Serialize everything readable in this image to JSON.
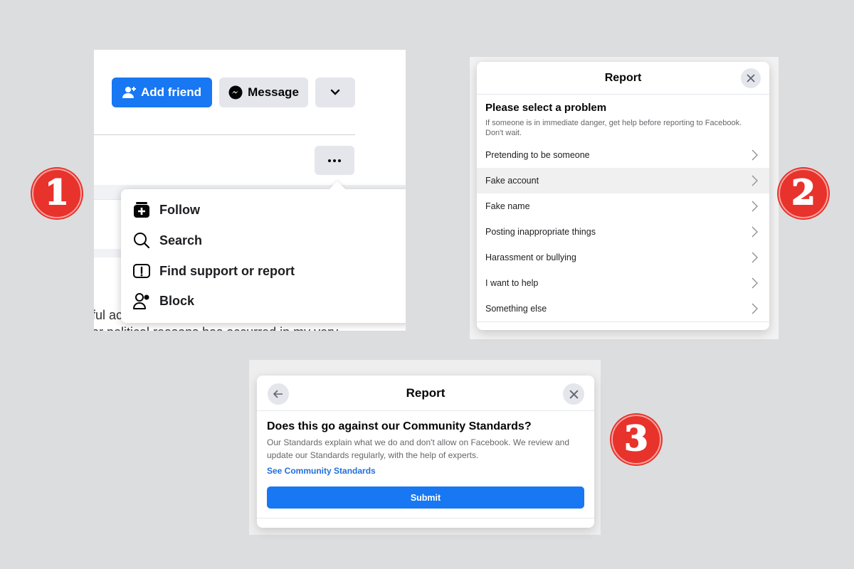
{
  "colors": {
    "background": "#dcdddf",
    "primary": "#1877f2",
    "secondary_button": "#e4e6eb",
    "link": "#216fdb",
    "badge": "#e8322c"
  },
  "step1": {
    "badge": "1",
    "profile_actions": {
      "add_friend_label": "Add friend",
      "add_friend_icon": "person-add-icon",
      "message_label": "Message",
      "message_icon": "messenger-icon",
      "more_dropdown_icon": "chevron-down-icon"
    },
    "more_button_icon": "ellipsis-icon",
    "menu": [
      {
        "label": "Follow",
        "icon": "follow-icon"
      },
      {
        "label": "Search",
        "icon": "search-icon"
      },
      {
        "label": "Find support or report",
        "icon": "report-icon"
      },
      {
        "label": "Block",
        "icon": "block-user-icon"
      }
    ],
    "background_text": [
      "ful ac",
      "or political reasons has occurred in my very"
    ]
  },
  "step2": {
    "badge": "2",
    "title": "Report",
    "heading": "Please select a problem",
    "subtext": "If someone is in immediate danger, get help before reporting to Facebook. Don't wait.",
    "problems": [
      {
        "label": "Pretending to be someone",
        "highlighted": false
      },
      {
        "label": "Fake account",
        "highlighted": true
      },
      {
        "label": "Fake name",
        "highlighted": false
      },
      {
        "label": "Posting inappropriate things",
        "highlighted": false
      },
      {
        "label": "Harassment or bullying",
        "highlighted": false
      },
      {
        "label": "I want to help",
        "highlighted": false
      },
      {
        "label": "Something else",
        "highlighted": false
      }
    ]
  },
  "step3": {
    "badge": "3",
    "title": "Report",
    "heading": "Does this go against our Community Standards?",
    "subtext": "Our Standards explain what we do and don't allow on Facebook. We review and update our Standards regularly, with the help of experts.",
    "link_label": "See Community Standards",
    "submit_label": "Submit"
  }
}
